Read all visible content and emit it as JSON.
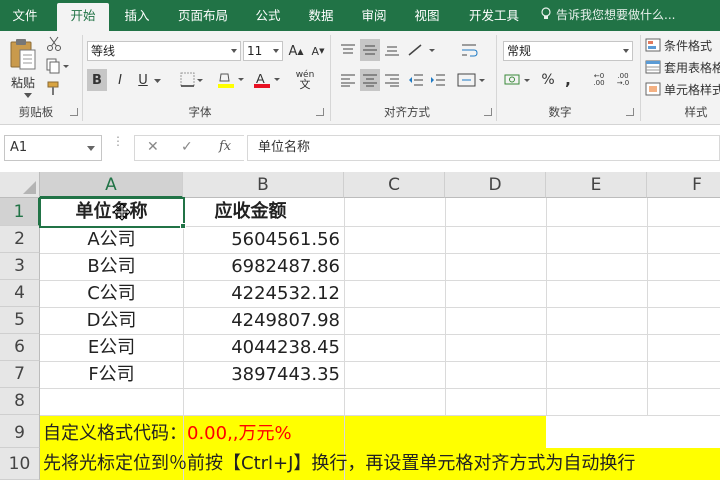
{
  "ribbon_tabs": [
    "文件",
    "开始",
    "插入",
    "页面布局",
    "公式",
    "数据",
    "审阅",
    "视图",
    "开发工具"
  ],
  "tell_me": "告诉我您想要做什么...",
  "clipboard": {
    "paste_label": "粘贴",
    "group": "剪贴板"
  },
  "font": {
    "name": "等线",
    "size": "11",
    "group": "字体",
    "bold": "B",
    "italic": "I",
    "underline": "U",
    "grow": "A",
    "shrink": "A",
    "wen": "wén"
  },
  "alignment": {
    "group": "对齐方式"
  },
  "number": {
    "format": "常规",
    "group": "数字",
    "percent": "%",
    "comma": ","
  },
  "styles": {
    "group": "样式",
    "conditional": "条件格式",
    "table": "套用表格格式",
    "cell": "单元格样式"
  },
  "formula_bar": {
    "name_box": "A1",
    "fx": "fx",
    "content": "单位名称",
    "cancel": "✕",
    "enter": "✓"
  },
  "columns": [
    "A",
    "B",
    "C",
    "D",
    "E",
    "F"
  ],
  "rows": [
    "1",
    "2",
    "3",
    "4",
    "5",
    "6",
    "7",
    "8",
    "9",
    "10"
  ],
  "table": {
    "headers": [
      "单位名称",
      "应收金额"
    ],
    "rows": [
      [
        "A公司",
        "5604561.56"
      ],
      [
        "B公司",
        "6982487.86"
      ],
      [
        "C公司",
        "4224532.12"
      ],
      [
        "D公司",
        "4249807.98"
      ],
      [
        "E公司",
        "4044238.45"
      ],
      [
        "F公司",
        "3897443.35"
      ]
    ]
  },
  "notes": {
    "line1_label": "自定义格式代码：",
    "line1_code": "0.00,,万元%",
    "line2": "先将光标定位到％前按【Ctrl+J】换行，再设置单元格对齐方式为自动换行"
  },
  "colors": {
    "brand": "#217346",
    "highlight": "#ffff00",
    "code_red": "#ff0000"
  }
}
